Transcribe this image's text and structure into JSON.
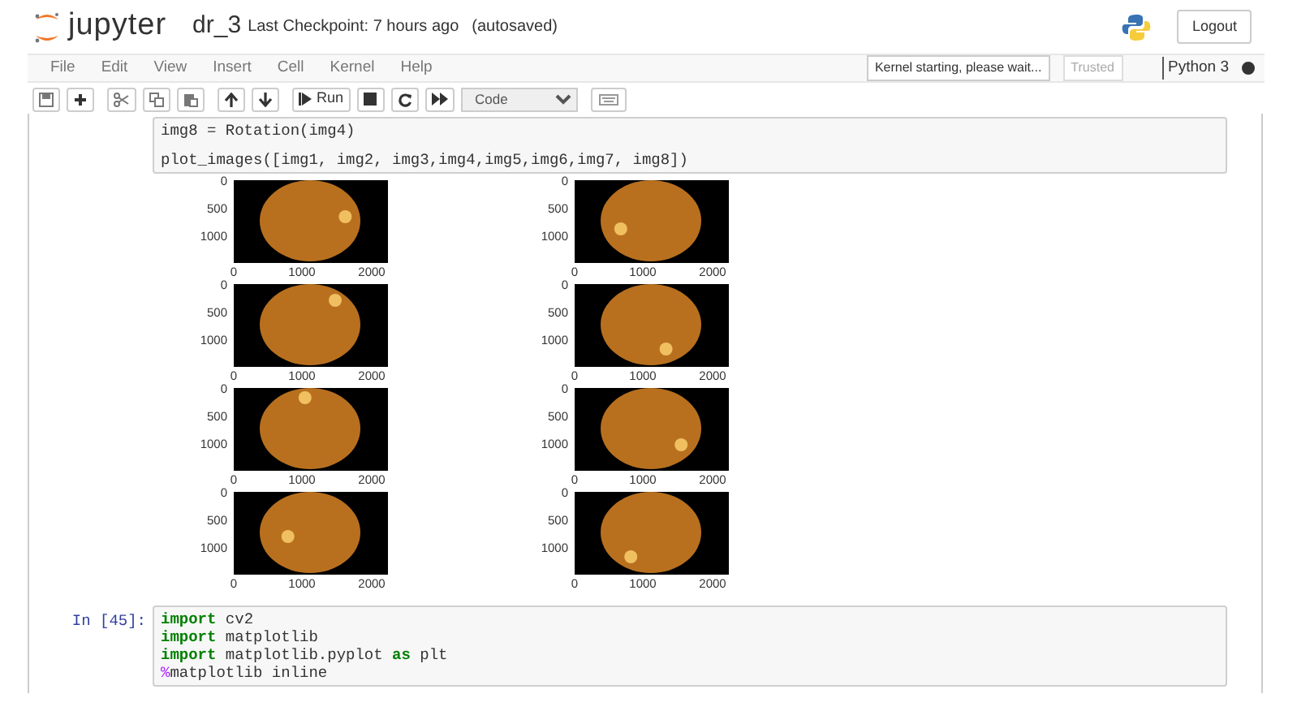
{
  "header": {
    "logo_text": "jupyter",
    "notebook_name": "dr_3",
    "checkpoint": "Last Checkpoint: 7 hours ago",
    "autosave": "(autosaved)",
    "logout": "Logout"
  },
  "menu": [
    "File",
    "Edit",
    "View",
    "Insert",
    "Cell",
    "Kernel",
    "Help"
  ],
  "kernel": {
    "status": "Kernel starting, please wait...",
    "trusted_label": "Trusted",
    "trusted": false,
    "name": "Python 3",
    "busy": true
  },
  "toolbar": {
    "run_label": "Run",
    "cell_type": "Code"
  },
  "cells": [
    {
      "lines": [
        {
          "tokens": [
            {
              "kind": "plain",
              "text": "img8 = Rotation(img4)"
            }
          ]
        },
        {
          "blank_before": true,
          "tokens": [
            {
              "kind": "plain",
              "text": "plot_images([img1, img2, img3,img4,img5,img6,img7, img8])"
            }
          ]
        }
      ],
      "output": {
        "subplots": [
          {
            "yticks": [
              "0",
              "500",
              "1000"
            ],
            "xticks": [
              "0",
              "1000",
              "2000"
            ]
          },
          {
            "yticks": [
              "0",
              "500",
              "1000"
            ],
            "xticks": [
              "0",
              "1000",
              "2000"
            ]
          },
          {
            "yticks": [
              "0",
              "500",
              "1000"
            ],
            "xticks": [
              "0",
              "1000",
              "2000"
            ]
          },
          {
            "yticks": [
              "0",
              "500",
              "1000"
            ],
            "xticks": [
              "0",
              "1000",
              "2000"
            ]
          },
          {
            "yticks": [
              "0",
              "500",
              "1000"
            ],
            "xticks": [
              "0",
              "1000",
              "2000"
            ]
          },
          {
            "yticks": [
              "0",
              "500",
              "1000"
            ],
            "xticks": [
              "0",
              "1000",
              "2000"
            ]
          },
          {
            "yticks": [
              "0",
              "500",
              "1000"
            ],
            "xticks": [
              "0",
              "1000",
              "2000"
            ]
          },
          {
            "yticks": [
              "0",
              "500",
              "1000"
            ],
            "xticks": [
              "0",
              "1000",
              "2000"
            ]
          }
        ]
      }
    },
    {
      "prompt": "In [45]:",
      "lines": [
        {
          "tokens": [
            {
              "kind": "keyword",
              "text": "import"
            },
            {
              "kind": "plain",
              "text": " cv2"
            }
          ]
        },
        {
          "tokens": [
            {
              "kind": "keyword",
              "text": "import"
            },
            {
              "kind": "plain",
              "text": " matplotlib"
            }
          ]
        },
        {
          "tokens": [
            {
              "kind": "keyword",
              "text": "import"
            },
            {
              "kind": "plain",
              "text": " matplotlib.pyplot "
            },
            {
              "kind": "keyword",
              "text": "as"
            },
            {
              "kind": "plain",
              "text": " plt"
            }
          ]
        },
        {
          "tokens": [
            {
              "kind": "magic",
              "text": "%"
            },
            {
              "kind": "plain",
              "text": "matplotlib inline"
            }
          ]
        }
      ]
    }
  ]
}
